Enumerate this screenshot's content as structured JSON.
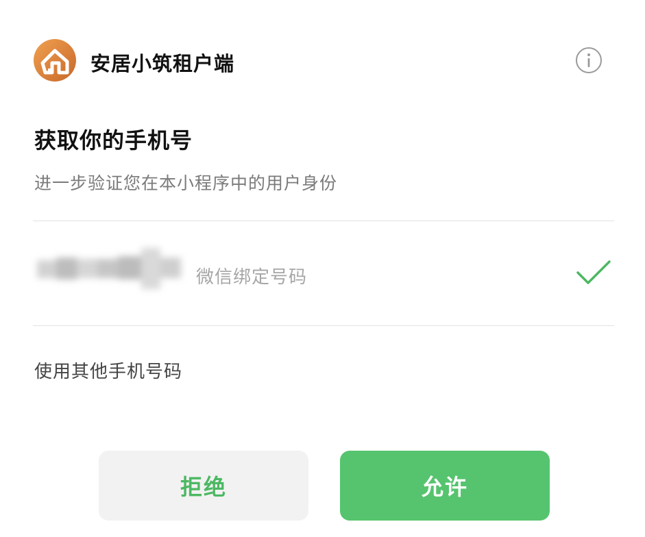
{
  "header": {
    "app_name": "安居小筑租户端",
    "logo_icon": "house-logo-icon",
    "info_icon": "info-circle-icon"
  },
  "main": {
    "title": "获取你的手机号",
    "subtitle": "进一步验证您在本小程序中的用户身份"
  },
  "phone_option": {
    "masked": true,
    "label": "微信绑定号码",
    "selected": true,
    "selected_icon": "checkmark-icon"
  },
  "other_number_link": "使用其他手机号码",
  "actions": {
    "reject_label": "拒绝",
    "allow_label": "允许"
  },
  "colors": {
    "accent_green": "#56c46e",
    "reject_text": "#4cb862",
    "logo_orange": "#e28a3a"
  }
}
